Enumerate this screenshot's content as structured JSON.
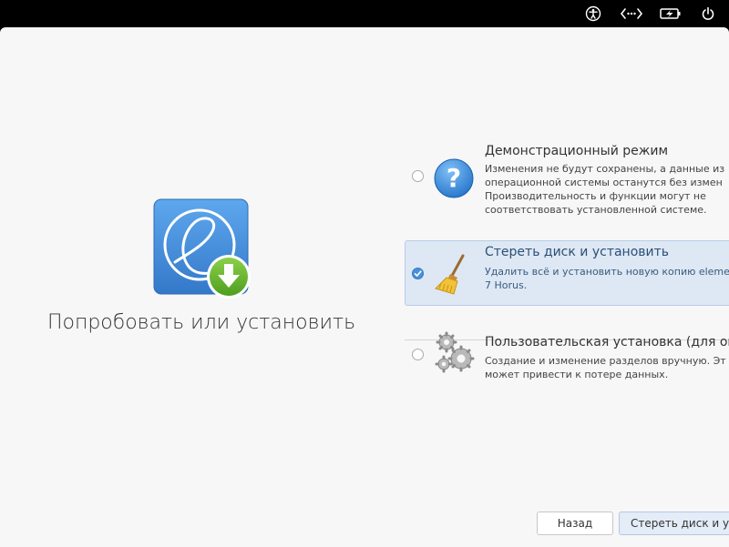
{
  "topbar": {
    "icons": [
      "accessibility-icon",
      "network-icon",
      "battery-charging-icon",
      "power-icon"
    ]
  },
  "left": {
    "title": "Попробовать или установить"
  },
  "options": [
    {
      "title": "Демонстрационный режим",
      "desc1": "Изменения не будут сохранены, а данные из",
      "desc2": "операционной системы останутся без измен",
      "desc3": "Производительность и функции могут не",
      "desc4": "соответствовать установленной системе.",
      "selected": false
    },
    {
      "title": "Стереть диск и установить",
      "desc1": "Удалить всё и установить новую копию eleme",
      "desc2": "7 Horus.",
      "selected": true
    },
    {
      "title": "Пользовательская установка (для оп",
      "desc1": "Создание и изменение разделов вручную. Эт",
      "desc2": "может привести к потере данных.",
      "selected": false
    }
  ],
  "buttons": {
    "back": "Назад",
    "install": "Стереть диск и уст"
  },
  "colors": {
    "accent": "#4a90d9",
    "selected_bg": "#dde8f4",
    "window_bg": "#f7f7f7"
  }
}
